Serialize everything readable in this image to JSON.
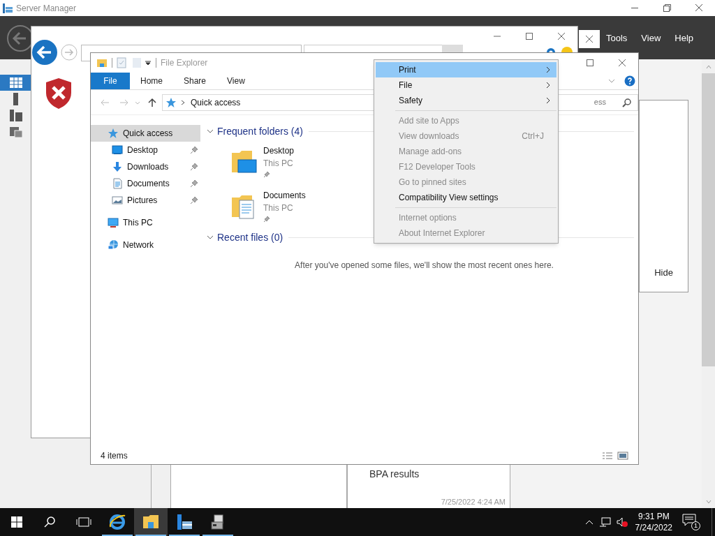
{
  "server_manager": {
    "title": "Server Manager",
    "menu": [
      "Tools",
      "View",
      "Help"
    ],
    "nav": [
      {
        "kind": "dashboard",
        "selected": true
      },
      {
        "kind": "server",
        "selected": false
      },
      {
        "kind": "servers",
        "selected": false
      },
      {
        "kind": "files",
        "selected": false
      }
    ],
    "side_button": "Hide",
    "tiles": [
      {
        "title": "BPA results",
        "time": "7/25/2022 4:24 AM"
      }
    ]
  },
  "file_explorer": {
    "title": "File Explorer",
    "ribbon_tabs": [
      {
        "label": "File",
        "selected": true
      },
      {
        "label": "Home",
        "selected": false
      },
      {
        "label": "Share",
        "selected": false
      },
      {
        "label": "View",
        "selected": false
      }
    ],
    "path": "Quick access",
    "search": "ess",
    "nav": [
      {
        "label": "Quick access",
        "kind": "star",
        "selected": true,
        "pinned": false,
        "children": [
          {
            "label": "Desktop",
            "kind": "desktop",
            "selected": false,
            "pinned": true
          },
          {
            "label": "Downloads",
            "kind": "downloads",
            "selected": false,
            "pinned": true
          },
          {
            "label": "Documents",
            "kind": "documents",
            "selected": false,
            "pinned": true
          },
          {
            "label": "Pictures",
            "kind": "pictures",
            "selected": false,
            "pinned": true
          }
        ]
      },
      {
        "label": "This PC",
        "kind": "pc",
        "selected": false,
        "pinned": false
      },
      {
        "label": "Network",
        "kind": "network",
        "selected": false,
        "pinned": false
      }
    ],
    "sections": [
      {
        "title": "Frequent folders (4)",
        "expanded": true,
        "items": [
          {
            "name": "Desktop",
            "location": "This PC",
            "kind": "desktop",
            "pinned": true
          },
          {
            "name": "Documents",
            "location": "This PC",
            "kind": "documents",
            "pinned": true
          }
        ]
      },
      {
        "title": "Recent files (0)",
        "expanded": true,
        "empty_text": "After you've opened some files, we'll show the most recent ones here."
      }
    ],
    "status": "4 items"
  },
  "tools_menu": {
    "items": [
      {
        "kind": "item",
        "label": "Print",
        "submenu": true,
        "disabled": false,
        "selected": true
      },
      {
        "kind": "item",
        "label": "File",
        "submenu": true,
        "disabled": false,
        "selected": false
      },
      {
        "kind": "item",
        "label": "Safety",
        "submenu": true,
        "disabled": false,
        "selected": false
      },
      {
        "kind": "separator"
      },
      {
        "kind": "item",
        "label": "Add site to Apps",
        "submenu": false,
        "disabled": true,
        "selected": false
      },
      {
        "kind": "item",
        "label": "View downloads",
        "shortcut": "Ctrl+J",
        "submenu": false,
        "disabled": true,
        "selected": false
      },
      {
        "kind": "item",
        "label": "Manage add-ons",
        "submenu": false,
        "disabled": true,
        "selected": false
      },
      {
        "kind": "item",
        "label": "F12 Developer Tools",
        "submenu": false,
        "disabled": true,
        "selected": false
      },
      {
        "kind": "item",
        "label": "Go to pinned sites",
        "submenu": false,
        "disabled": true,
        "selected": false
      },
      {
        "kind": "item",
        "label": "Compatibility View settings",
        "submenu": false,
        "disabled": false,
        "selected": false
      },
      {
        "kind": "separator"
      },
      {
        "kind": "item",
        "label": "Internet options",
        "submenu": false,
        "disabled": true,
        "selected": false
      },
      {
        "kind": "item",
        "label": "About Internet Explorer",
        "submenu": false,
        "disabled": true,
        "selected": false
      }
    ]
  },
  "taskbar": {
    "apps": [
      {
        "kind": "ie",
        "running": true,
        "selected": false
      },
      {
        "kind": "explorer",
        "running": true,
        "selected": true
      },
      {
        "kind": "server_manager",
        "running": true,
        "selected": false
      },
      {
        "kind": "tool",
        "running": true,
        "selected": false
      }
    ],
    "time": "9:31 PM",
    "date": "7/24/2022",
    "notifications": "1"
  }
}
